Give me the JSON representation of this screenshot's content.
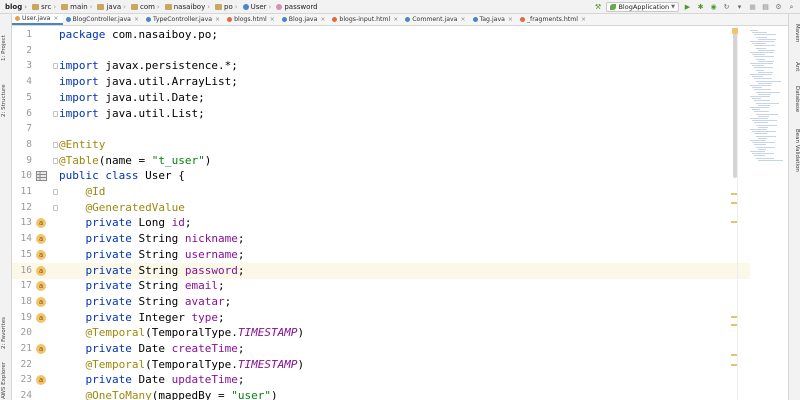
{
  "breadcrumb": [
    "blog",
    "src",
    "main",
    "java",
    "com",
    "nasaiboy",
    "po",
    "User",
    "password"
  ],
  "run_config": {
    "label": "BlogApplication"
  },
  "tabs": [
    {
      "label": "User.java",
      "active": true
    },
    {
      "label": "BlogController.java",
      "active": false
    },
    {
      "label": "TypeController.java",
      "active": false
    },
    {
      "label": "blogs.html",
      "active": false
    },
    {
      "label": "Blog.java",
      "active": false
    },
    {
      "label": "blogs-input.html",
      "active": false
    },
    {
      "label": "Comment.java",
      "active": false
    },
    {
      "label": "Tag.java",
      "active": false
    },
    {
      "label": "_fragments.html",
      "active": false
    }
  ],
  "left_tools": [
    "1: Project",
    "2: Structure",
    "2: Favorites",
    "AWS Explorer"
  ],
  "right_tools": [
    "Maven",
    "Ant",
    "Database",
    "Bean Validation"
  ],
  "current_line": 16,
  "code_lines": [
    {
      "n": "1",
      "gutter": "",
      "html": "<span class=\"kw\">package</span> com.nasaiboy.po;"
    },
    {
      "n": "2",
      "gutter": "",
      "html": ""
    },
    {
      "n": "3",
      "gutter": "",
      "html": "<span class=\"kw\">import</span> javax.persistence.*;"
    },
    {
      "n": "4",
      "gutter": "",
      "html": "<span class=\"kw\">import</span> java.util.ArrayList;"
    },
    {
      "n": "5",
      "gutter": "",
      "html": "<span class=\"kw\">import</span> java.util.Date;"
    },
    {
      "n": "6",
      "gutter": "",
      "html": "<span class=\"kw\">import</span> java.util.List;"
    },
    {
      "n": "7",
      "gutter": "",
      "html": ""
    },
    {
      "n": "8",
      "gutter": "",
      "html": "<span class=\"an\">@Entity</span>"
    },
    {
      "n": "9",
      "gutter": "",
      "html": "<span class=\"an\">@Table</span>(name = <span class=\"st\">\"t_user\"</span>)"
    },
    {
      "n": "10",
      "gutter": "db",
      "html": "<span class=\"kw\">public class</span> User {"
    },
    {
      "n": "11",
      "gutter": "",
      "html": "    <span class=\"an\">@Id</span>"
    },
    {
      "n": "12",
      "gutter": "",
      "html": "    <span class=\"an\">@GeneratedValue</span>"
    },
    {
      "n": "13",
      "gutter": "a",
      "html": "    <span class=\"kw\">private</span> Long <span class=\"fd\">id</span>;"
    },
    {
      "n": "14",
      "gutter": "a",
      "html": "    <span class=\"kw\">private</span> String <span class=\"fd\">nickname</span>;"
    },
    {
      "n": "15",
      "gutter": "a",
      "html": "    <span class=\"kw\">private</span> String <span class=\"fd\">username</span>;"
    },
    {
      "n": "16",
      "gutter": "a",
      "html": "    <span class=\"kw\">private</span> String <span class=\"fd\">password</span>;"
    },
    {
      "n": "17",
      "gutter": "a",
      "html": "    <span class=\"kw\">private</span> String <span class=\"fd\">email</span>;"
    },
    {
      "n": "18",
      "gutter": "a",
      "html": "    <span class=\"kw\">private</span> String <span class=\"fd\">avatar</span>;"
    },
    {
      "n": "19",
      "gutter": "a",
      "html": "    <span class=\"kw\">private</span> Integer <span class=\"fd\">type</span>;"
    },
    {
      "n": "20",
      "gutter": "",
      "html": "    <span class=\"an\">@Temporal</span>(TemporalType.<span class=\"it\">TIMESTAMP</span>)"
    },
    {
      "n": "21",
      "gutter": "a",
      "html": "    <span class=\"kw\">private</span> Date <span class=\"fd\">createTime</span>;"
    },
    {
      "n": "22",
      "gutter": "",
      "html": "    <span class=\"an\">@Temporal</span>(TemporalType.<span class=\"it\">TIMESTAMP</span>)"
    },
    {
      "n": "23",
      "gutter": "a",
      "html": "    <span class=\"kw\">private</span> Date <span class=\"fd\">updateTime</span>;"
    },
    {
      "n": "24",
      "gutter": "",
      "html": "    <span class=\"an\">@OneToMany</span>(mappedBy = <span class=\"st\">\"user\"</span>)"
    }
  ],
  "gutter_badge": "a"
}
